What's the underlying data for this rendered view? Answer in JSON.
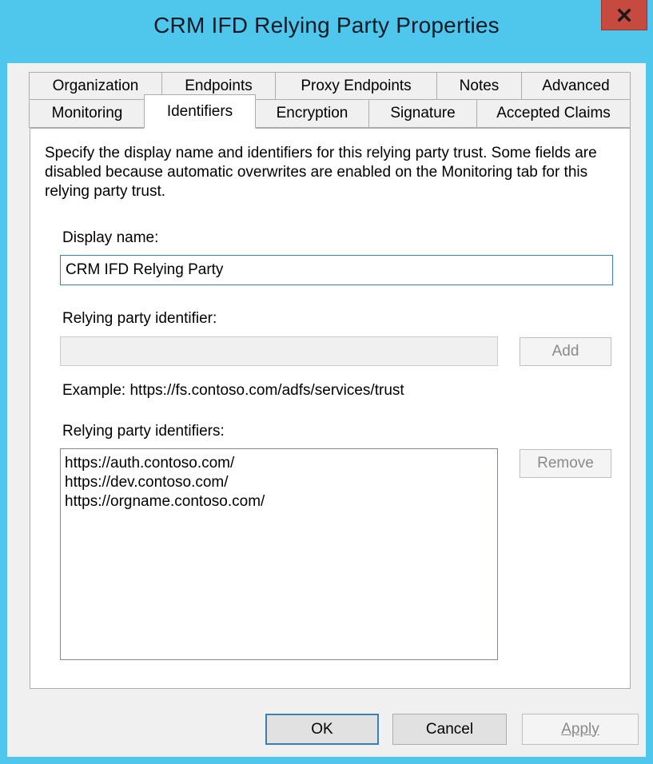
{
  "window": {
    "title": "CRM IFD Relying Party Properties",
    "close_glyph": "x",
    "title_bar_color": "#4fc6ec",
    "close_button_color": "#c64a3f"
  },
  "tabs": {
    "row1": [
      "Organization",
      "Endpoints",
      "Proxy Endpoints",
      "Notes",
      "Advanced"
    ],
    "row2": [
      "Monitoring",
      "Identifiers",
      "Encryption",
      "Signature",
      "Accepted Claims"
    ],
    "selected": "Identifiers"
  },
  "identifiers_tab": {
    "description": "Specify the display name and identifiers for this relying party trust. Some fields are disabled because automatic overwrites are enabled on the Monitoring tab for this relying party trust.",
    "display_name_label": "Display name:",
    "display_name_value": "CRM IFD Relying Party",
    "rp_identifier_label": "Relying party identifier:",
    "rp_identifier_value": "",
    "add_label": "Add",
    "example_text": "Example: https://fs.contoso.com/adfs/services/trust",
    "rp_identifiers_label": "Relying party identifiers:",
    "identifiers": [
      "https://auth.contoso.com/",
      "https://dev.contoso.com/",
      "https://orgname.contoso.com/"
    ],
    "remove_label": "Remove"
  },
  "footer": {
    "ok_label": "OK",
    "cancel_label": "Cancel",
    "apply_label": "Apply"
  }
}
